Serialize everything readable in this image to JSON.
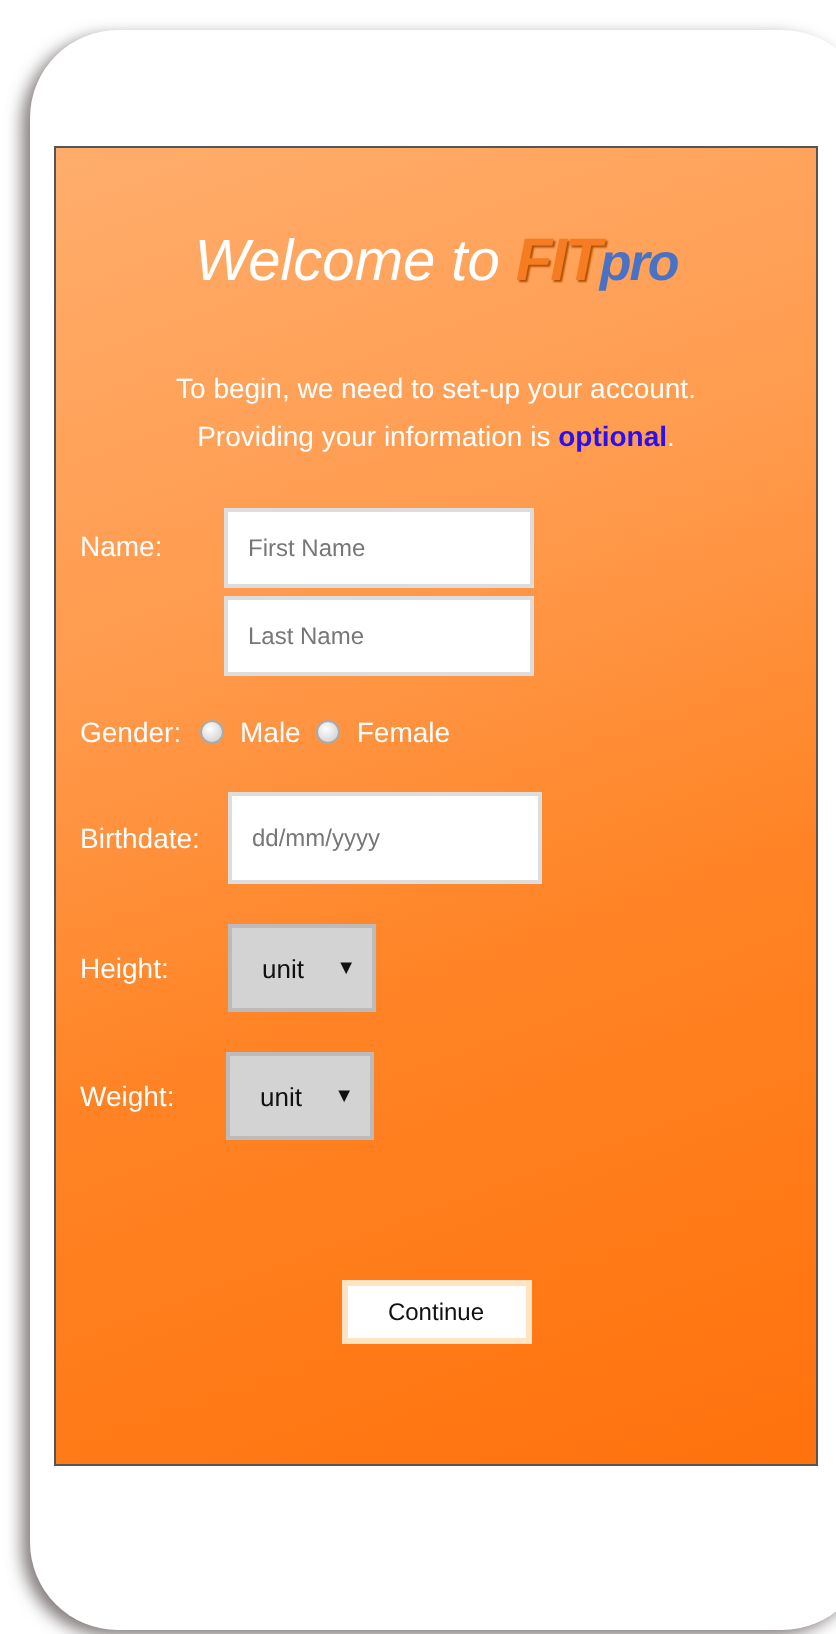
{
  "header": {
    "welcome": "Welcome to",
    "logo_primary": "FIT",
    "logo_secondary": "pro"
  },
  "intro": {
    "line_1": "To begin, we need to set-up your account.",
    "line_2": "Providing your information is **optional**."
  },
  "name": {
    "label": "Name:",
    "first_placeholder": "First Name",
    "last_placeholder": "Last Name"
  },
  "gender": {
    "label": "Gender:",
    "options": [
      {
        "label": "Male",
        "selected": false
      },
      {
        "label": "Female",
        "selected": false
      }
    ]
  },
  "birthdate": {
    "label": "Birthdate:",
    "placeholder": "dd/mm/yyyy"
  },
  "height": {
    "label": "Height:",
    "value": "unit",
    "arrow": "▼"
  },
  "weight": {
    "label": "Weight:",
    "value": "unit",
    "arrow": "▼"
  },
  "continue_button": "Continue"
}
